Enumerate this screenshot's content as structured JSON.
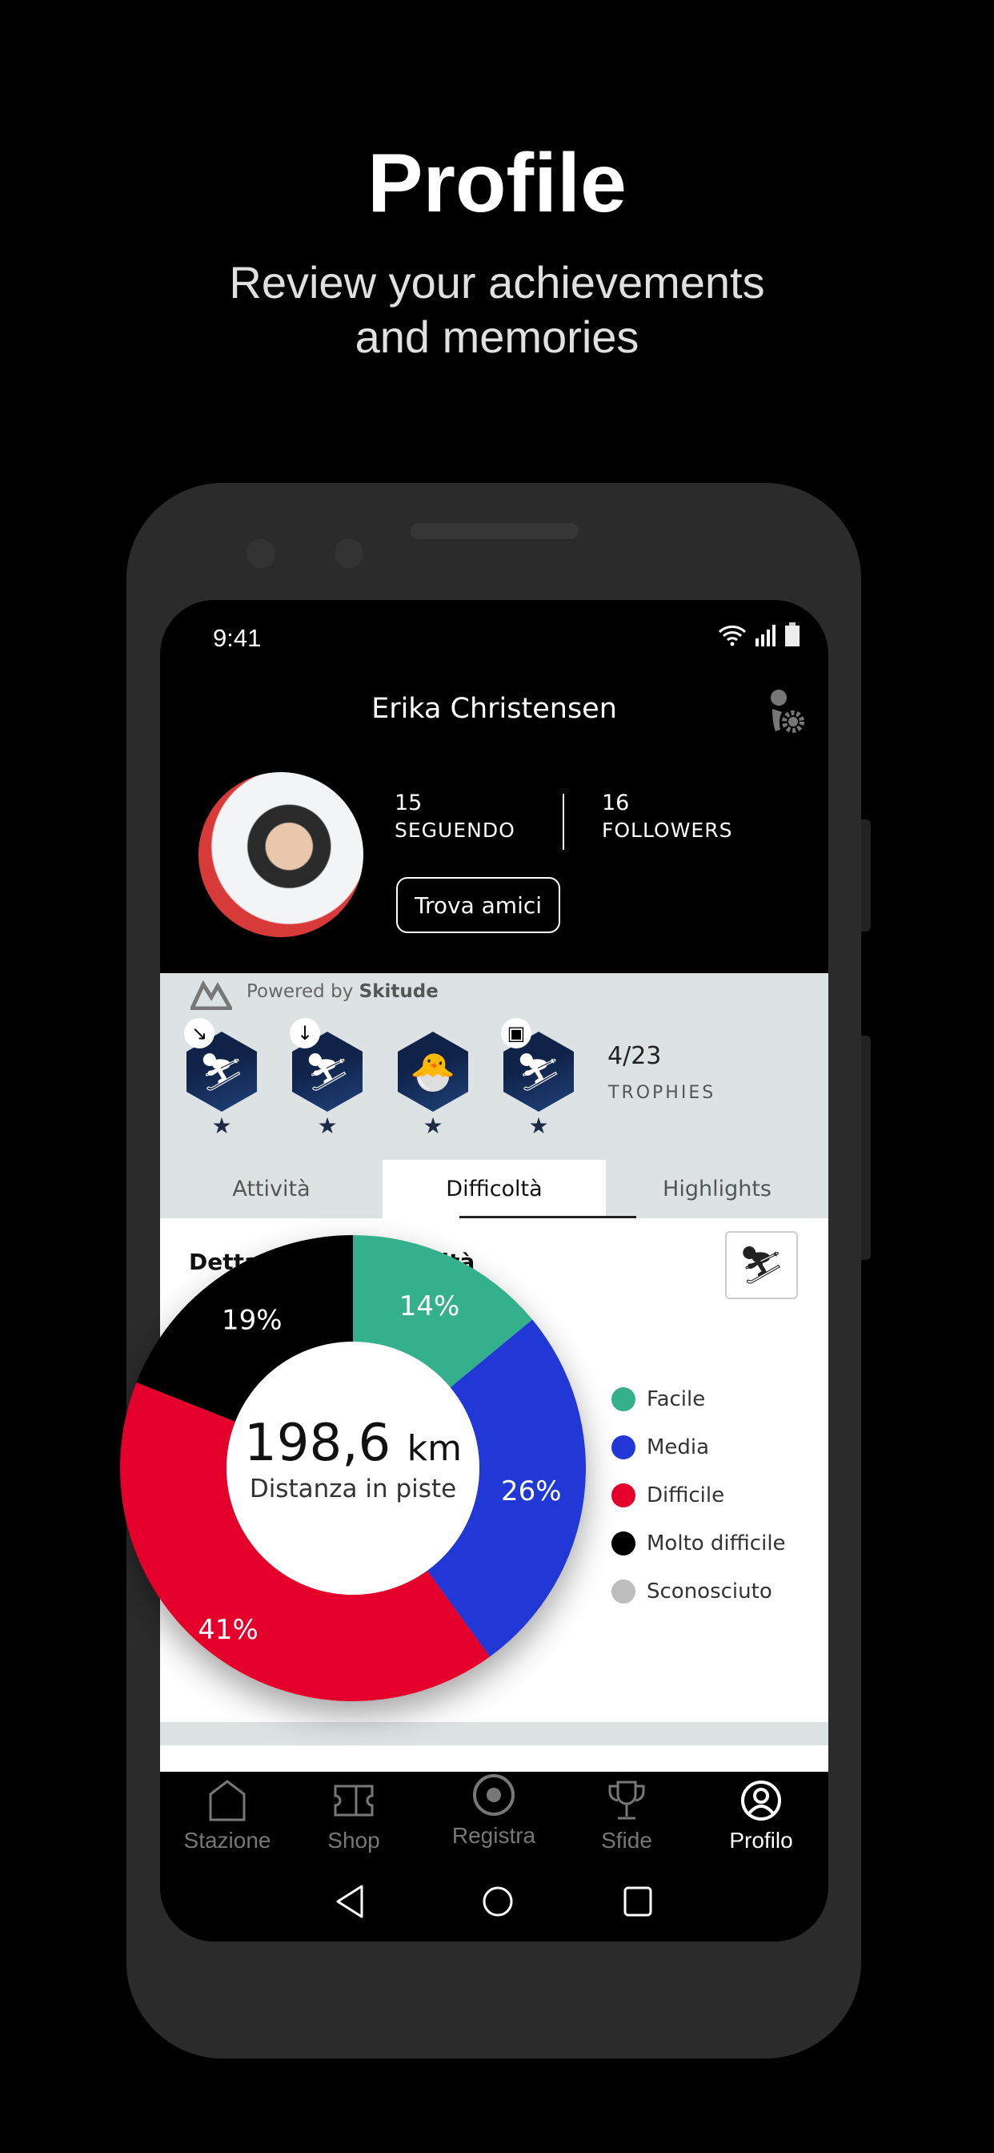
{
  "hero": {
    "title": "Profile",
    "subtitle_line1": "Review your achievements",
    "subtitle_line2": "and memories"
  },
  "status": {
    "time": "9:41"
  },
  "profile": {
    "name": "Erika Christensen",
    "following_count": "15",
    "following_label": "SEGUENDO",
    "followers_count": "16",
    "followers_label": "FOLLOWERS",
    "find_friends": "Trova amici"
  },
  "powered": {
    "prefix": "Powered by",
    "brand": "Skitude"
  },
  "trophies": {
    "count": "4/23",
    "label": "TROPHIES",
    "badges": [
      "skier-diagonal",
      "skier-down",
      "chick",
      "skier-calendar"
    ]
  },
  "tabs": [
    "Attività",
    "Difficoltà",
    "Highlights"
  ],
  "active_tab": "Difficoltà",
  "section_title": "Dettaglio per difficoltà",
  "chart_data": {
    "type": "pie",
    "donut": true,
    "center_value": "198,6",
    "center_unit": "km",
    "center_label": "Distanza in piste",
    "series": [
      {
        "name": "Facile",
        "value": 14,
        "label": "14%",
        "color": "#34b08c"
      },
      {
        "name": "Media",
        "value": 26,
        "label": "26%",
        "color": "#2238d6"
      },
      {
        "name": "Difficile",
        "value": 41,
        "label": "41%",
        "color": "#e4002b"
      },
      {
        "name": "Molto difficile",
        "value": 19,
        "label": "19%",
        "color": "#000000"
      },
      {
        "name": "Sconosciuto",
        "value": 0,
        "label": "",
        "color": "#bdbdbd"
      }
    ],
    "legend_placement": "right"
  },
  "nav": [
    {
      "label": "Stazione",
      "icon": "home-icon"
    },
    {
      "label": "Shop",
      "icon": "ticket-icon"
    },
    {
      "label": "Registra",
      "icon": "record-icon"
    },
    {
      "label": "Sfide",
      "icon": "trophy-icon"
    },
    {
      "label": "Profilo",
      "icon": "profile-icon",
      "active": true
    }
  ]
}
